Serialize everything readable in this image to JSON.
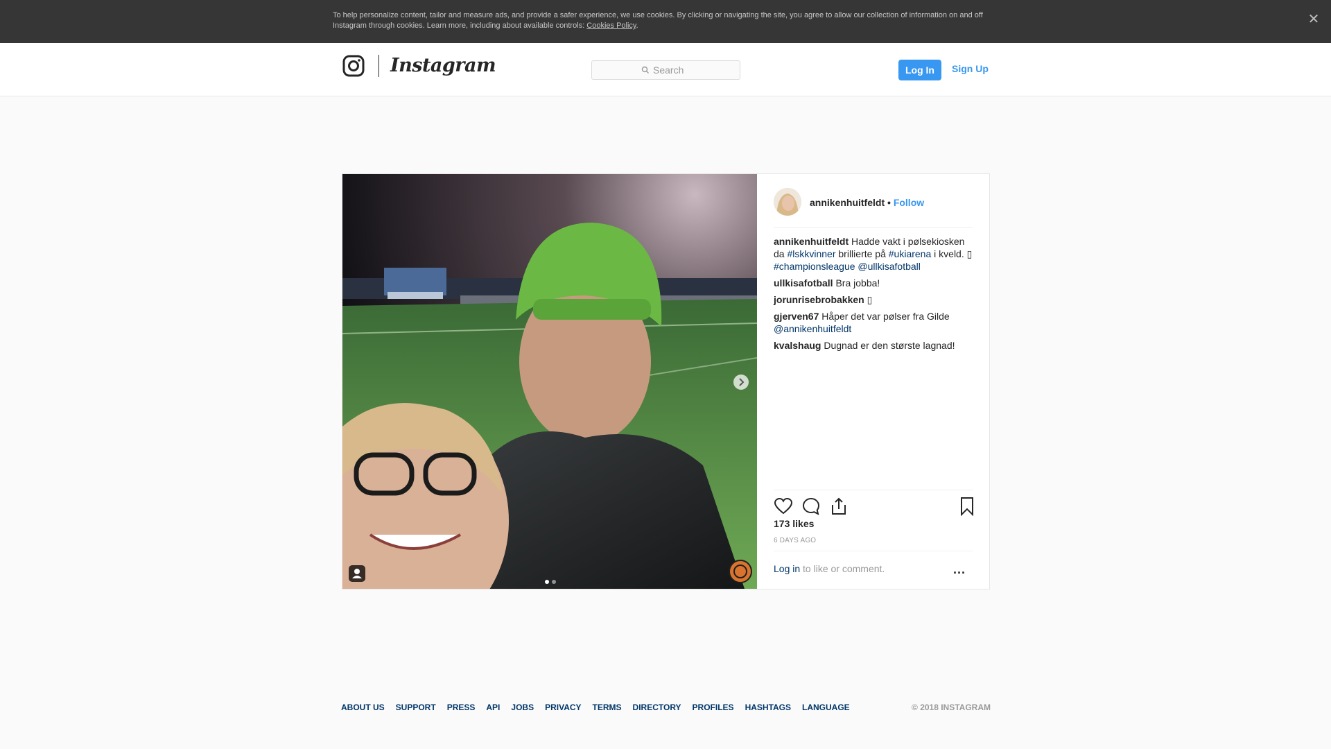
{
  "cookie_banner": {
    "text": "To help personalize content, tailor and measure ads, and provide a safer experience, we use cookies. By clicking or navigating the site, you agree to allow our collection of information on and off Instagram through cookies. Learn more, including about available controls: ",
    "link": "Cookies Policy",
    "suffix": ".",
    "close_icon": "close-icon"
  },
  "header": {
    "logo_word": "Instagram",
    "search_placeholder": "Search",
    "login_label": "Log In",
    "signup_label": "Sign Up"
  },
  "post": {
    "username": "annikenhuitfeldt",
    "dot": " • ",
    "follow_label": "Follow",
    "comments": [
      {
        "user": "annikenhuitfeldt",
        "parts": [
          " Hadde vakt i pølsekiosken da ",
          {
            "link": "#lskkvinner"
          },
          " brillierte på ",
          {
            "link": "#ukiarena"
          },
          " i kveld. ▯ ",
          {
            "link": "#championsleague"
          },
          " ",
          {
            "link": "@ullkisafotball"
          }
        ]
      },
      {
        "user": "ullkisafotball",
        "parts": [
          " Bra jobba!"
        ]
      },
      {
        "user": "jorunrisebrobakken",
        "parts": [
          " ▯"
        ]
      },
      {
        "user": "gjerven67",
        "parts": [
          " Håper det var pølser fra Gilde ",
          {
            "link": "@annikenhuitfeldt"
          }
        ]
      },
      {
        "user": "kvalshaug",
        "parts": [
          " Dugnad er den største lagnad!"
        ]
      }
    ],
    "likes": "173 likes",
    "time": "6 DAYS AGO",
    "login_link": "Log in",
    "login_suffix": " to like or comment.",
    "more_label": "...",
    "carousel": {
      "current": 1,
      "total": 2
    }
  },
  "footer": {
    "links": [
      "ABOUT US",
      "SUPPORT",
      "PRESS",
      "API",
      "JOBS",
      "PRIVACY",
      "TERMS",
      "DIRECTORY",
      "PROFILES",
      "HASHTAGS",
      "LANGUAGE"
    ],
    "copyright": "© 2018 INSTAGRAM"
  },
  "colors": {
    "accent": "#3897f0",
    "link": "#003569",
    "banner_bg": "#363636"
  }
}
